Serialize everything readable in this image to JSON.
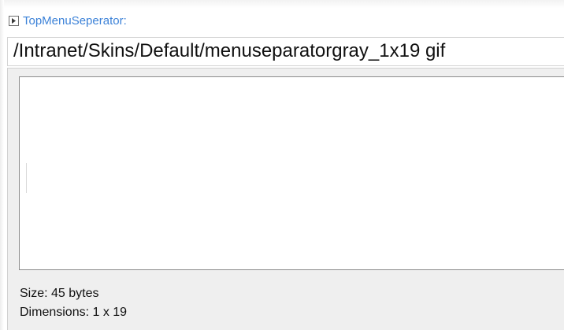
{
  "property": {
    "expand_icon": "triangle-right-icon",
    "name": "TopMenuSeperator:"
  },
  "path": {
    "value": "/Intranet/Skins/Default/menuseparatorgray_1x19 gif"
  },
  "preview": {
    "size_text": "Size: 45 bytes",
    "dimensions_text": "Dimensions: 1 x 19"
  },
  "colors": {
    "link": "#3c82d8",
    "panel": "#efefef",
    "border": "#8c8c8c"
  }
}
